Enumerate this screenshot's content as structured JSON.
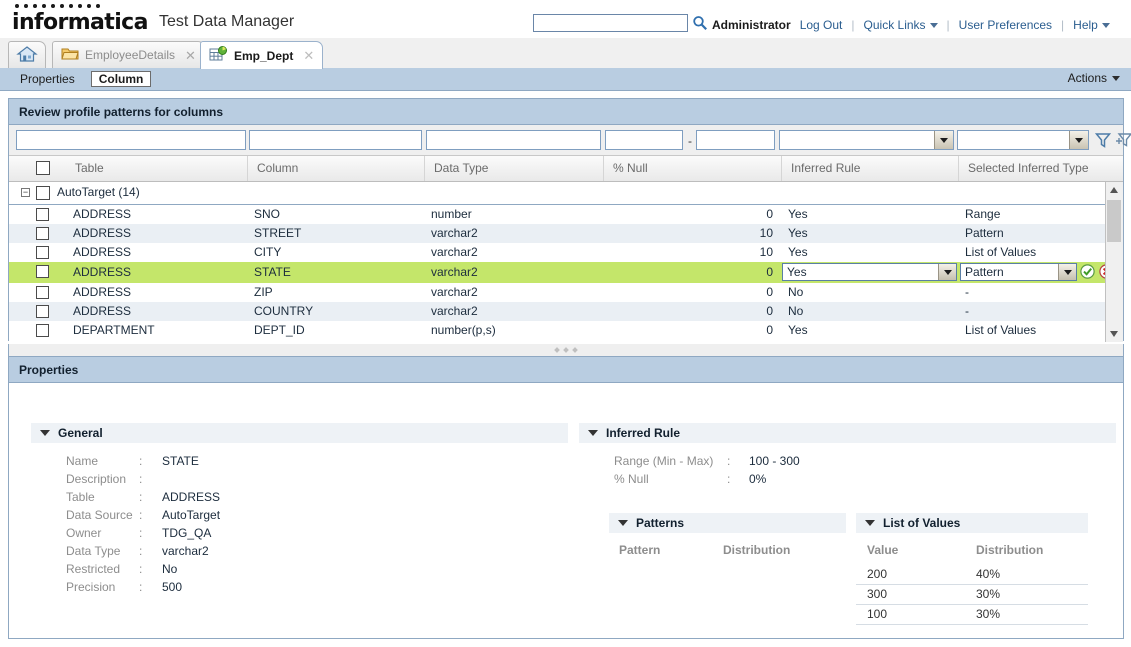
{
  "masthead": {
    "brand": "informatica",
    "product": "Test Data Manager",
    "search_value": "",
    "search_placeholder": "",
    "user": "Administrator",
    "links": [
      {
        "label": "Log Out",
        "caret": false
      },
      {
        "label": "Quick Links",
        "caret": true
      },
      {
        "label": "User Preferences",
        "caret": false
      },
      {
        "label": "Help",
        "caret": true
      }
    ]
  },
  "tabs": [
    {
      "label": "EmployeeDetails",
      "active": false,
      "close": "✕"
    },
    {
      "label": "Emp_Dept",
      "active": true,
      "close": "✕"
    }
  ],
  "subbar": {
    "tabs": [
      {
        "label": "Properties",
        "active": false
      },
      {
        "label": "Column",
        "active": true
      }
    ],
    "actions_label": "Actions"
  },
  "review_panel": {
    "title": "Review profile patterns for columns",
    "filters": {
      "table": "",
      "column": "",
      "data_type": "",
      "null_min": "",
      "null_max": "",
      "null_separator": "-",
      "inferred_rule": "",
      "selected_inferred_type": ""
    },
    "filter_buttons": [
      {
        "name": "apply-filter-icon",
        "title": "Filter"
      },
      {
        "name": "clear-filter-icon",
        "title": "Clear Filter"
      }
    ],
    "columns": [
      "Table",
      "Column",
      "Data Type",
      "% Null",
      "Inferred Rule",
      "Selected Inferred Type"
    ],
    "group": {
      "label": "AutoTarget (14)",
      "expander": "−"
    },
    "rows": [
      {
        "table": "ADDRESS",
        "column": "SNO",
        "data_type": "number",
        "null_pct": "0",
        "inferred_rule": "Yes",
        "selected_type": "Range",
        "editing": false
      },
      {
        "table": "ADDRESS",
        "column": "STREET",
        "data_type": "varchar2",
        "null_pct": "10",
        "inferred_rule": "Yes",
        "selected_type": "Pattern",
        "editing": false
      },
      {
        "table": "ADDRESS",
        "column": "CITY",
        "data_type": "varchar2",
        "null_pct": "10",
        "inferred_rule": "Yes",
        "selected_type": "List of Values",
        "editing": false
      },
      {
        "table": "ADDRESS",
        "column": "STATE",
        "data_type": "varchar2",
        "null_pct": "0",
        "inferred_rule": "Yes",
        "selected_type": "Pattern",
        "editing": true
      },
      {
        "table": "ADDRESS",
        "column": "ZIP",
        "data_type": "varchar2",
        "null_pct": "0",
        "inferred_rule": "No",
        "selected_type": "-",
        "editing": false
      },
      {
        "table": "ADDRESS",
        "column": "COUNTRY",
        "data_type": "varchar2",
        "null_pct": "0",
        "inferred_rule": "No",
        "selected_type": "-",
        "editing": false
      },
      {
        "table": "DEPARTMENT",
        "column": "DEPT_ID",
        "data_type": "number(p,s)",
        "null_pct": "0",
        "inferred_rule": "Yes",
        "selected_type": "List of Values",
        "editing": false
      }
    ],
    "row_actions": {
      "accept": "✓",
      "cancel": "✕"
    }
  },
  "properties_panel": {
    "title": "Properties",
    "general": {
      "heading": "General",
      "fields": [
        {
          "key": "Name",
          "value": "STATE"
        },
        {
          "key": "Description",
          "value": ""
        },
        {
          "key": "Table",
          "value": "ADDRESS"
        },
        {
          "key": "Data Source",
          "value": "AutoTarget"
        },
        {
          "key": "Owner",
          "value": "TDG_QA"
        },
        {
          "key": "Data Type",
          "value": "varchar2"
        },
        {
          "key": "Restricted",
          "value": "No"
        },
        {
          "key": "Precision",
          "value": "500"
        }
      ]
    },
    "inferred_rule": {
      "heading": "Inferred Rule",
      "fields": [
        {
          "key": "Range (Min - Max)",
          "value": "100 - 300"
        },
        {
          "key": "% Null",
          "value": "0%"
        }
      ]
    },
    "patterns": {
      "heading": "Patterns",
      "columns": [
        "Pattern",
        "Distribution"
      ],
      "rows": []
    },
    "list_of_values": {
      "heading": "List of Values",
      "columns": [
        "Value",
        "Distribution"
      ],
      "rows": [
        {
          "value": "200",
          "distribution": "40%"
        },
        {
          "value": "300",
          "distribution": "30%"
        },
        {
          "value": "100",
          "distribution": "30%"
        }
      ]
    }
  },
  "colors": {
    "header_band": "#b9cde1",
    "selected_row": "#c4e66a",
    "alt_row": "#eaeff4",
    "link": "#2a5d8f",
    "accept_green": "#3f9b28",
    "cancel_red": "#cc2222"
  }
}
